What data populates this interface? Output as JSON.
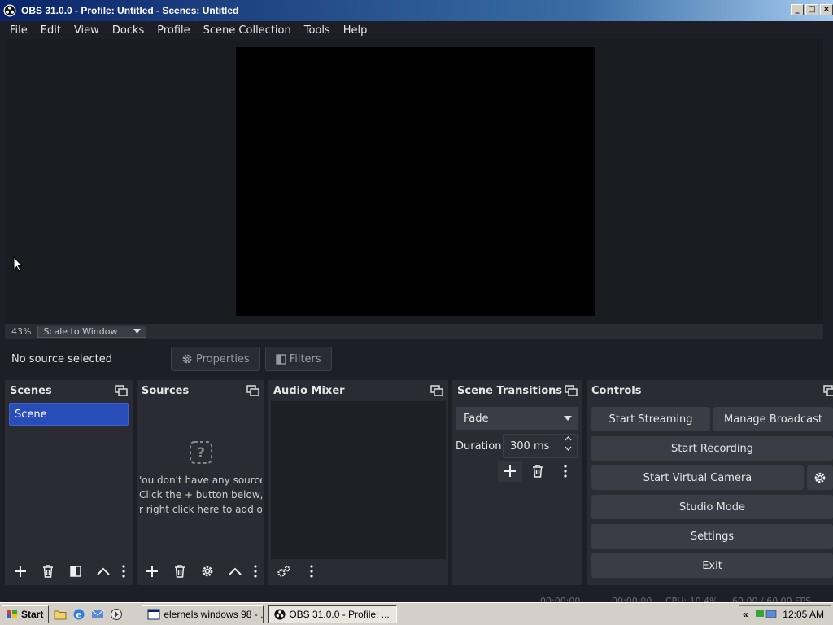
{
  "window": {
    "title": "OBS 31.0.0 - Profile: Untitled - Scenes: Untitled"
  },
  "menu": [
    "File",
    "Edit",
    "View",
    "Docks",
    "Profile",
    "Scene Collection",
    "Tools",
    "Help"
  ],
  "preview": {
    "zoom": "43%",
    "scale_mode": "Scale to Window"
  },
  "context": {
    "no_source": "No source selected",
    "properties": "Properties",
    "filters": "Filters"
  },
  "docks": {
    "scenes": {
      "title": "Scenes",
      "items": [
        "Scene"
      ]
    },
    "sources": {
      "title": "Sources",
      "empty_lines": [
        "'ou don't have any source",
        "Click the + button below,",
        "r right click here to add or"
      ]
    },
    "mixer": {
      "title": "Audio Mixer"
    },
    "transitions": {
      "title": "Scene Transitions",
      "selected": "Fade",
      "duration_label": "Duration",
      "duration_value": "300 ms"
    },
    "controls": {
      "title": "Controls",
      "start_streaming": "Start Streaming",
      "manage_broadcast": "Manage Broadcast",
      "start_recording": "Start Recording",
      "start_virtual_camera": "Start Virtual Camera",
      "studio_mode": "Studio Mode",
      "settings": "Settings",
      "exit": "Exit"
    }
  },
  "statusbar": {
    "stream_time": "00:00:00",
    "record_time": "00:00:00",
    "cpu": "CPU: 10.4%",
    "fps": "60.00 / 60.00 FPS"
  },
  "taskbar": {
    "start": "Start",
    "task1": "elernels windows 98 - ...",
    "task2": "OBS 31.0.0 - Profile: ...",
    "clock": "12:05 AM"
  },
  "colors": {
    "accent": "#284cb8",
    "panel": "#2a2b33",
    "background": "#1e1f26"
  }
}
